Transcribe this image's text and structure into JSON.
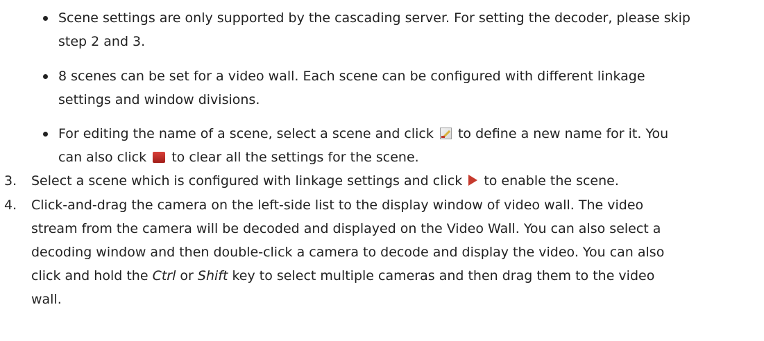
{
  "bullets": [
    {
      "lines": [
        "Scene settings are only supported by the cascading server. For setting the decoder, please skip",
        "step 2 and 3."
      ]
    },
    {
      "lines": [
        "8 scenes can be set for a video wall. Each scene can be configured with different linkage",
        "settings and window divisions."
      ]
    },
    {
      "line1_a": "For editing the name of a scene, select a scene and click",
      "line1_b": "to define a new name for it. You",
      "line2_a": "can also click",
      "line2_b": "to clear all the settings for the scene.",
      "icons": [
        "edit-icon",
        "clear-icon"
      ]
    }
  ],
  "steps": [
    {
      "number": "3.",
      "text_a": "Select a scene which is configured with linkage settings and click",
      "text_b": "to enable the scene.",
      "icon": "play-icon"
    },
    {
      "number": "4.",
      "lines": [
        "Click-and-drag the camera on the left-side list to the display window of video wall. The video",
        "stream from the camera will be decoded and displayed on the Video Wall. You can also select a",
        "decoding window and then double-click a camera to decode and display the video. You can also"
      ],
      "line4_a": "click and hold the",
      "key1": "Ctrl",
      "line4_b": "or",
      "key2": "Shift",
      "line4_c": "key to select multiple cameras and then drag them to the video",
      "line5": "wall."
    }
  ]
}
